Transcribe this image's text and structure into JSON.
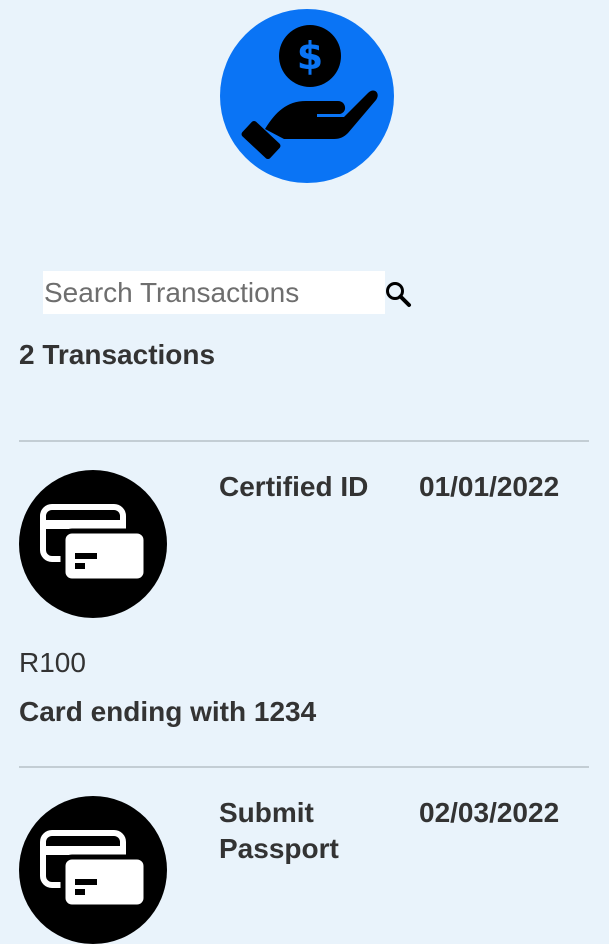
{
  "header": {
    "logo_icon": "hand-holding-dollar-icon",
    "logo_color": "#0a74f5"
  },
  "search": {
    "placeholder": "Search Transactions",
    "value": "",
    "icon": "search-icon"
  },
  "summary": {
    "count_label": "2 Transactions"
  },
  "transactions": [
    {
      "icon": "credit-cards-icon",
      "name": "Certified ID",
      "date": "01/01/2022",
      "amount": "R100",
      "card": "Card ending with 1234"
    },
    {
      "icon": "credit-cards-icon",
      "name": "Submit Passport",
      "date": "02/03/2022"
    }
  ],
  "colors": {
    "background": "#e9f3fb",
    "text": "#333333",
    "divider": "#c3cdd4"
  }
}
